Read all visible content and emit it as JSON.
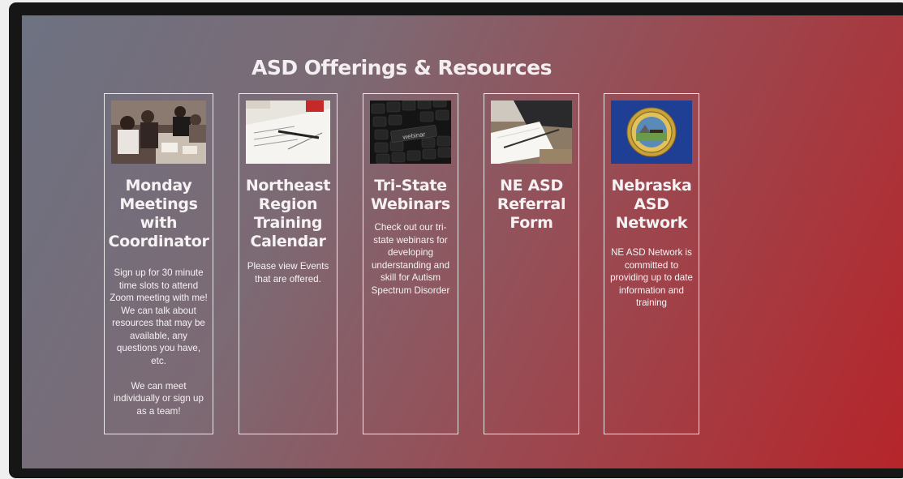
{
  "page": {
    "title": "ASD Offerings & Resources"
  },
  "cards": [
    {
      "image_alt": "people in a meeting",
      "heading": "Monday Meetings with Coordinator",
      "paragraphs": [
        "Sign up for 30 minute time slots to attend Zoom meeting with me! We can talk about resources that may be available, any questions you have, etc.",
        "We can meet individually or sign up as a team!"
      ]
    },
    {
      "image_alt": "notebook and pen",
      "heading": "Northeast Region Training Calendar",
      "paragraphs": [
        "Please view Events that are offered."
      ]
    },
    {
      "image_alt": "keyboard with webinar key",
      "heading": "Tri-State Webinars",
      "paragraphs": [
        "Check out our tri-state webinars for developing understanding and skill for Autism Spectrum Disorder"
      ]
    },
    {
      "image_alt": "notepad and laptop",
      "heading": "NE ASD Referral Form",
      "paragraphs": []
    },
    {
      "image_alt": "Nebraska state flag",
      "heading": "Nebraska ASD Network",
      "paragraphs": [
        "NE ASD Network is committed to providing up to date information and training"
      ]
    }
  ],
  "keyboard_key_text": "webinar",
  "colors": {
    "gradient_start": "#6d7282",
    "gradient_end": "#b5252a",
    "text": "#f6f2f3",
    "flag_blue": "#1e3f94",
    "seal_gold": "#c9a23a"
  }
}
